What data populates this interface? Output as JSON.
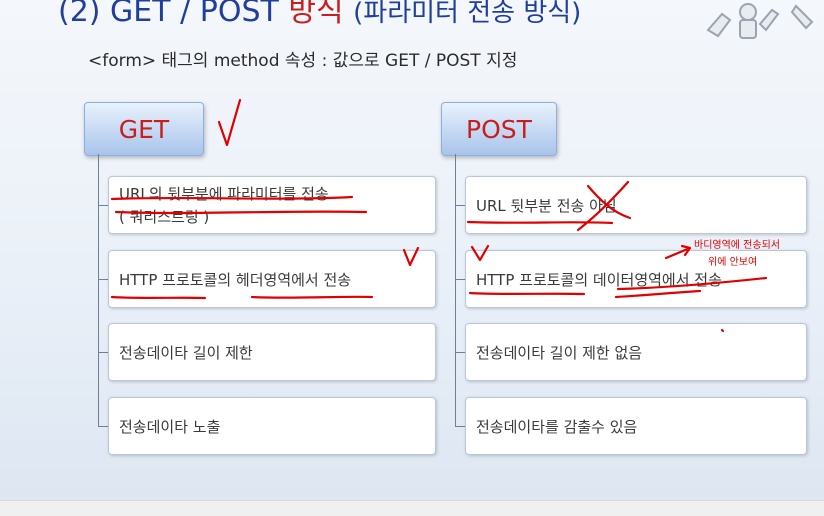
{
  "slide": {
    "title_num": "(2)",
    "title_main": "GET / POST",
    "title_red": "방식",
    "title_sub": "(파라미터 전송 방식)",
    "subtitle": "<form> 태그의 method 속성 : 값으로 GET / POST 지정"
  },
  "get": {
    "header": "GET",
    "items": [
      {
        "line1": "URL의 뒷부분에 파라미터를 전송",
        "line2": "( 쿼리스트링 )"
      },
      {
        "line1": "HTTP 프로토콜의 헤더영역에서 전송"
      },
      {
        "line1": "전송데이타 길이 제한"
      },
      {
        "line1": "전송데이타 노출"
      }
    ]
  },
  "post": {
    "header": "POST",
    "items": [
      {
        "line1": "URL 뒷부분 전송 아님"
      },
      {
        "line1": "HTTP 프로토콜의 데이터영역에서 전송"
      },
      {
        "line1": "전송데이타 길이 제한 없음"
      },
      {
        "line1": "전송데이타를 감출수 있음"
      }
    ]
  },
  "annotations": {
    "note_line1": "바디영역에 전송되서",
    "note_line2": "위에 안보여"
  },
  "colors": {
    "title_blue": "#1f3f9a",
    "title_red": "#c81e1e",
    "ink_red": "#e00000"
  }
}
